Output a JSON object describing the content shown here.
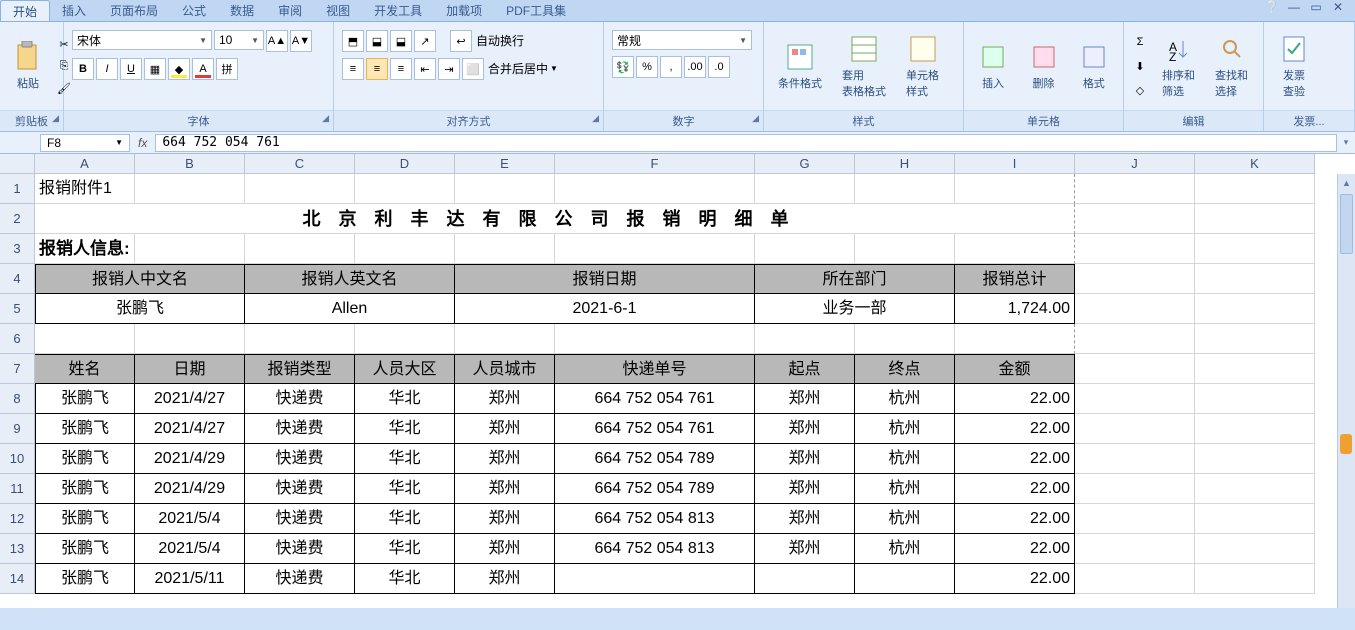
{
  "ribbon_tabs": [
    "开始",
    "插入",
    "页面布局",
    "公式",
    "数据",
    "审阅",
    "视图",
    "开发工具",
    "加载项",
    "PDF工具集"
  ],
  "active_tab_index": 0,
  "help_icon": "❔",
  "window_controls": [
    "▭",
    "▭",
    "✕"
  ],
  "groups": {
    "clipboard": {
      "label": "剪贴板",
      "paste": "粘贴"
    },
    "font": {
      "label": "字体",
      "name": "宋体",
      "size": "10"
    },
    "align": {
      "label": "对齐方式",
      "wrap": "自动换行",
      "merge": "合并后居中"
    },
    "number": {
      "label": "数字",
      "format": "常规"
    },
    "styles": {
      "label": "样式",
      "cond": "条件格式",
      "table": "套用\n表格格式",
      "cell": "单元格\n样式"
    },
    "cells_g": {
      "label": "单元格",
      "insert": "插入",
      "delete": "删除",
      "format": "格式"
    },
    "editing": {
      "label": "编辑",
      "sort": "排序和\n筛选",
      "find": "查找和\n选择"
    },
    "invoice": {
      "label": "发票...",
      "check": "发票\n查验"
    }
  },
  "namebox": "F8",
  "formula": "664 752 054 761",
  "columns": [
    "A",
    "B",
    "C",
    "D",
    "E",
    "F",
    "G",
    "H",
    "I",
    "J",
    "K"
  ],
  "row_numbers": [
    1,
    2,
    3,
    4,
    5,
    6,
    7,
    8,
    9,
    10,
    11,
    12,
    13,
    14
  ],
  "sheet": {
    "r1": "报销附件1",
    "r2_title": "北京利丰达有限公司报销明细单",
    "r3_label": "报销人信息:",
    "r4": [
      "报销人中文名",
      "报销人英文名",
      "报销日期",
      "所在部门",
      "报销总计"
    ],
    "r5": [
      "张鹏飞",
      "Allen",
      "2021-6-1",
      "业务一部",
      "1,724.00"
    ],
    "r7": [
      "姓名",
      "日期",
      "报销类型",
      "人员大区",
      "人员城市",
      "快递单号",
      "起点",
      "终点",
      "金额"
    ],
    "rows": [
      [
        "张鹏飞",
        "2021/4/27",
        "快递费",
        "华北",
        "郑州",
        "664 752 054 761",
        "郑州",
        "杭州",
        "22.00"
      ],
      [
        "张鹏飞",
        "2021/4/27",
        "快递费",
        "华北",
        "郑州",
        "664 752 054 761",
        "郑州",
        "杭州",
        "22.00"
      ],
      [
        "张鹏飞",
        "2021/4/29",
        "快递费",
        "华北",
        "郑州",
        "664 752 054 789",
        "郑州",
        "杭州",
        "22.00"
      ],
      [
        "张鹏飞",
        "2021/4/29",
        "快递费",
        "华北",
        "郑州",
        "664 752 054 789",
        "郑州",
        "杭州",
        "22.00"
      ],
      [
        "张鹏飞",
        "2021/5/4",
        "快递费",
        "华北",
        "郑州",
        "664 752 054 813",
        "郑州",
        "杭州",
        "22.00"
      ],
      [
        "张鹏飞",
        "2021/5/4",
        "快递费",
        "华北",
        "郑州",
        "664 752 054 813",
        "郑州",
        "杭州",
        "22.00"
      ],
      [
        "张鹏飞",
        "2021/5/11",
        "快递费",
        "华北",
        "郑州",
        "",
        "",
        "",
        "22.00"
      ]
    ]
  }
}
